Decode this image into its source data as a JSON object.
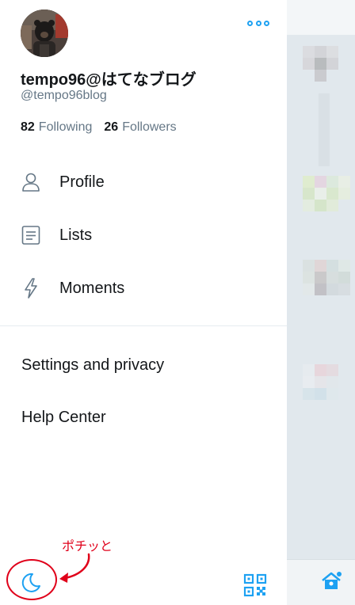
{
  "profile": {
    "display_name": "tempo96@はてなブログ",
    "handle": "@tempo96blog",
    "following_count": "82",
    "following_label": "Following",
    "followers_count": "26",
    "followers_label": "Followers"
  },
  "menu": {
    "items": [
      {
        "label": "Profile",
        "icon": "person-icon"
      },
      {
        "label": "Lists",
        "icon": "list-icon"
      },
      {
        "label": "Moments",
        "icon": "lightning-icon"
      }
    ],
    "settings_label": "Settings and privacy",
    "help_label": "Help Center"
  },
  "bottom_bar": {
    "night_mode_icon": "moon-icon",
    "qr_icon": "qr-code-icon"
  },
  "annotation": {
    "text": "ポチッと",
    "color": "#e0001a"
  },
  "colors": {
    "accent": "#1da1f2",
    "text_primary": "#14171a",
    "text_secondary": "#657786"
  }
}
